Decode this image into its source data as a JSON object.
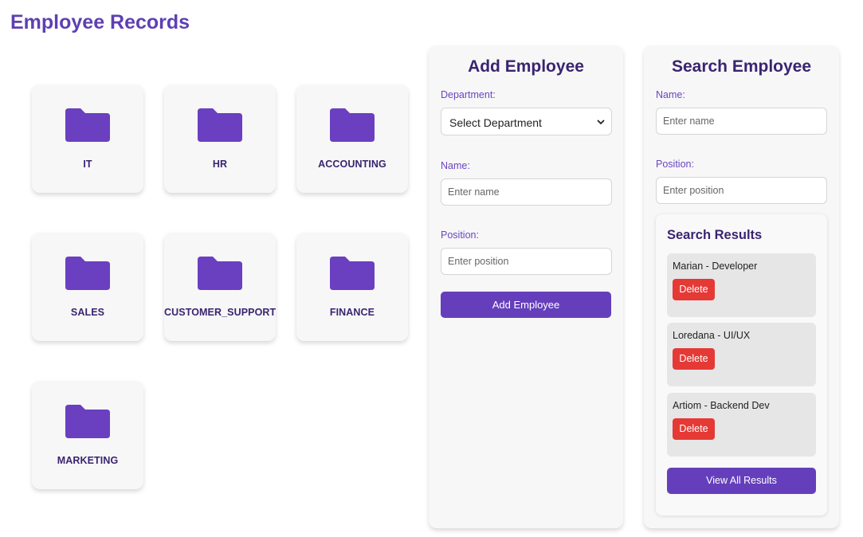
{
  "page": {
    "title": "Employee Records"
  },
  "folders": [
    {
      "label": "IT",
      "icon": "folder-icon"
    },
    {
      "label": "HR",
      "icon": "folder-icon"
    },
    {
      "label": "ACCOUNTING",
      "icon": "folder-icon"
    },
    {
      "label": "SALES",
      "icon": "folder-icon"
    },
    {
      "label": "CUSTOMER_SUPPORT",
      "icon": "folder-icon"
    },
    {
      "label": "FINANCE",
      "icon": "folder-icon"
    },
    {
      "label": "MARKETING",
      "icon": "folder-icon"
    }
  ],
  "add_employee": {
    "title": "Add Employee",
    "department_label": "Department:",
    "department_value": "Select Department",
    "name_label": "Name:",
    "name_placeholder": "Enter name",
    "position_label": "Position:",
    "position_placeholder": "Enter position",
    "submit_label": "Add Employee"
  },
  "search_employee": {
    "title": "Search Employee",
    "name_label": "Name:",
    "name_placeholder": "Enter name",
    "position_label": "Position:",
    "position_placeholder": "Enter position",
    "results": {
      "title": "Search Results",
      "items": [
        {
          "text": "Marian - Developer",
          "delete_label": "Delete"
        },
        {
          "text": "Loredana - UI/UX",
          "delete_label": "Delete"
        },
        {
          "text": "Artiom - Backend Dev",
          "delete_label": "Delete"
        }
      ],
      "view_all_label": "View All Results"
    }
  },
  "colors": {
    "accent": "#653fbb",
    "title": "#5e3fb3",
    "folder": "#6a3fc0",
    "danger": "#e53935"
  }
}
